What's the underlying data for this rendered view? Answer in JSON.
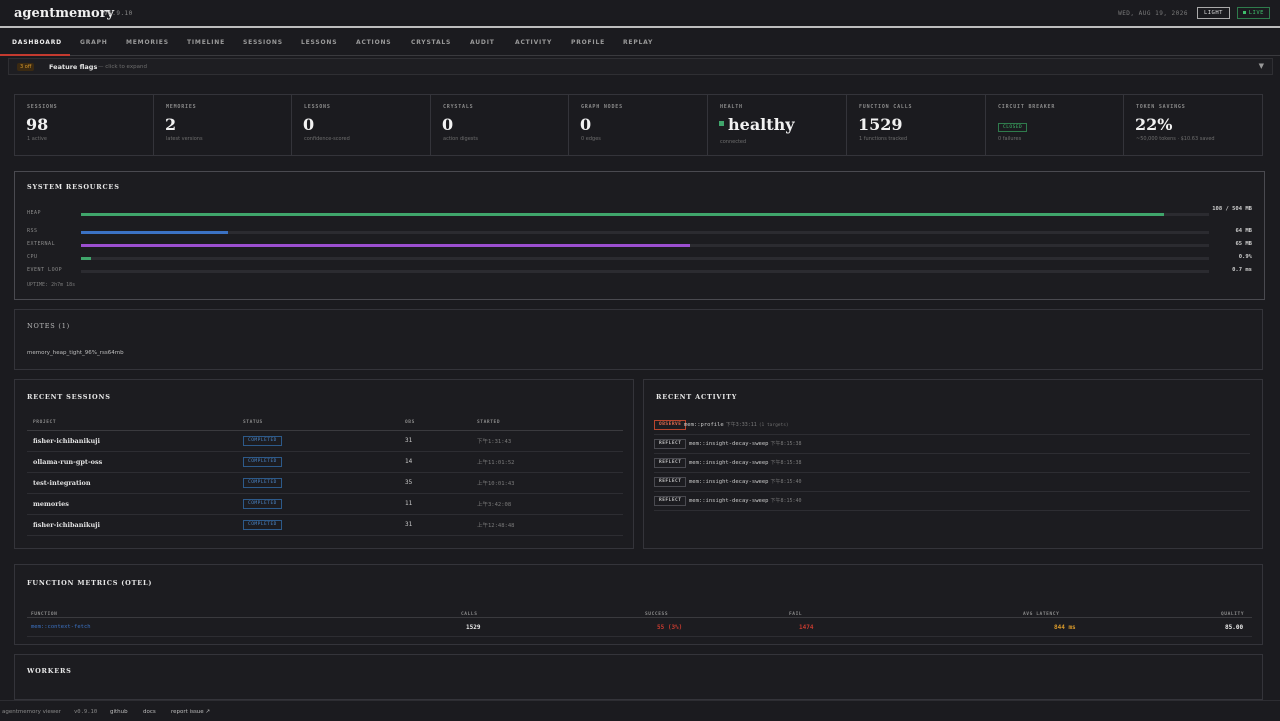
{
  "header": {
    "brand": "agentmemory",
    "version": "v0.9.10",
    "date": "WED, AUG 19, 2026",
    "theme_button": "LIGHT",
    "live_label": "LIVE"
  },
  "tabs": [
    {
      "label": "DASHBOARD",
      "active": true
    },
    {
      "label": "GRAPH"
    },
    {
      "label": "MEMORIES"
    },
    {
      "label": "TIMELINE"
    },
    {
      "label": "SESSIONS"
    },
    {
      "label": "LESSONS"
    },
    {
      "label": "ACTIONS"
    },
    {
      "label": "CRYSTALS"
    },
    {
      "label": "AUDIT"
    },
    {
      "label": "ACTIVITY"
    },
    {
      "label": "PROFILE"
    },
    {
      "label": "REPLAY"
    }
  ],
  "feature_flags": {
    "badge": "3 off",
    "title": "Feature flags",
    "hint": "— click to expand",
    "chevron_icon": "chevron-down-icon"
  },
  "stats": [
    {
      "label": "SESSIONS",
      "value": "98",
      "sub": "1 active"
    },
    {
      "label": "MEMORIES",
      "value": "2",
      "sub": "latest versions"
    },
    {
      "label": "LESSONS",
      "value": "0",
      "sub": "confidence-scored"
    },
    {
      "label": "CRYSTALS",
      "value": "0",
      "sub": "action digests"
    },
    {
      "label": "GRAPH NODES",
      "value": "0",
      "sub": "0 edges"
    },
    {
      "label": "HEALTH",
      "value": "healthy",
      "sub": "connected"
    },
    {
      "label": "FUNCTION CALLS",
      "value": "1529",
      "sub": "1 functions tracked"
    },
    {
      "label": "CIRCUIT BREAKER",
      "badge": "CLOSED",
      "sub": "0 failures"
    },
    {
      "label": "TOKEN SAVINGS",
      "value": "22%",
      "sub": "~50,000 tokens · $10.63 saved"
    }
  ],
  "resources": {
    "title": "SYSTEM RESOURCES",
    "rows": [
      {
        "label": "HEAP",
        "value": "108 / 504 MB",
        "fraction": 0.96,
        "color": "#3fa56b"
      },
      {
        "label": "RSS",
        "value": "64 MB",
        "fraction": 0.13,
        "color": "#3b72c4"
      },
      {
        "label": "EXTERNAL",
        "value": "65 MB",
        "fraction": 0.54,
        "color": "#9b4fd0"
      },
      {
        "label": "CPU",
        "value": "0.9%",
        "fraction": 0.009,
        "color": "#3fa56b"
      },
      {
        "label": "EVENT LOOP",
        "value": "0.7 ms",
        "fraction": 0.0,
        "color": "#3fa56b"
      }
    ],
    "uptime": "UPTIME: 2h7m 18s"
  },
  "notes": {
    "title": "NOTES (1)",
    "items": [
      "memory_heap_tight_96%_rss64mb"
    ]
  },
  "sessions": {
    "title": "RECENT SESSIONS",
    "columns": [
      "PROJECT",
      "STATUS",
      "OBS",
      "STARTED"
    ],
    "rows": [
      {
        "project": "fisher-ichibanikuji",
        "status": "COMPLETED",
        "obs": "31",
        "started": "下午1:31:43"
      },
      {
        "project": "ollama-run-gpt-oss",
        "status": "COMPLETED",
        "obs": "14",
        "started": "上午11:01:52"
      },
      {
        "project": "test-integration",
        "status": "COMPLETED",
        "obs": "35",
        "started": "上午10:01:43"
      },
      {
        "project": "memories",
        "status": "COMPLETED",
        "obs": "11",
        "started": "上午3:42:08"
      },
      {
        "project": "fisher-ichibanikuji",
        "status": "COMPLETED",
        "obs": "31",
        "started": "上午12:48:48"
      }
    ]
  },
  "activity": {
    "title": "RECENT ACTIVITY",
    "rows": [
      {
        "tag": "OBSERVE",
        "kind": "observe",
        "text": "mem::profile",
        "time": "下午3:33:11",
        "extra": "(1 targets)"
      },
      {
        "tag": "REFLECT",
        "kind": "reflect",
        "text": "mem::insight-decay-sweep",
        "time": "下午8:15:38",
        "extra": ""
      },
      {
        "tag": "REFLECT",
        "kind": "reflect",
        "text": "mem::insight-decay-sweep",
        "time": "下午8:15:38",
        "extra": ""
      },
      {
        "tag": "REFLECT",
        "kind": "reflect",
        "text": "mem::insight-decay-sweep",
        "time": "下午8:15:40",
        "extra": ""
      },
      {
        "tag": "REFLECT",
        "kind": "reflect",
        "text": "mem::insight-decay-sweep",
        "time": "下午8:15:40",
        "extra": ""
      }
    ]
  },
  "metrics": {
    "title": "FUNCTION METRICS (OTEL)",
    "columns": [
      "FUNCTION",
      "CALLS",
      "SUCCESS",
      "FAIL",
      "AVG LATENCY",
      "QUALITY"
    ],
    "rows": [
      {
        "function": "mem::context-fetch",
        "calls": "1529",
        "success": "55 (3%)",
        "fail": "1474",
        "latency": "844 ms",
        "quality": "85.00"
      }
    ],
    "colors": {
      "function": "#3b72c4",
      "success": "#c43a2f",
      "fail": "#c43a2f",
      "latency": "#d99a2b",
      "calls": "#e8e8e8",
      "quality": "#e8e8e8"
    }
  },
  "workers": {
    "title": "WORKERS"
  },
  "footer": {
    "name": "agentmemory viewer",
    "version": "v0.9.10",
    "github": "github",
    "docs": "docs",
    "report": "report issue ↗"
  }
}
